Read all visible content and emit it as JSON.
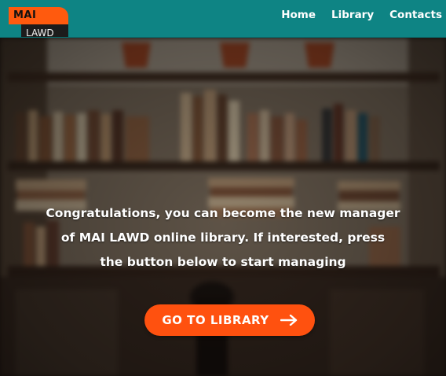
{
  "header": {
    "logo": {
      "line1": "MAI",
      "line2": "LAWD"
    },
    "nav": [
      {
        "label": "Home"
      },
      {
        "label": "Library"
      },
      {
        "label": "Contacts"
      }
    ]
  },
  "hero": {
    "message_lines": [
      "Congratulations, you can become the new manager",
      "of MAI LAWD online library. If interested, press",
      "the button below to start managing"
    ],
    "cta_label": "GO TO LIBRARY",
    "cta_icon": "arrow-right-icon",
    "background_image": "blurred-bookshelf-photo"
  },
  "colors": {
    "header": "#0e8484",
    "accent": "#ff510f",
    "logo_dark": "#1c1c1c"
  }
}
